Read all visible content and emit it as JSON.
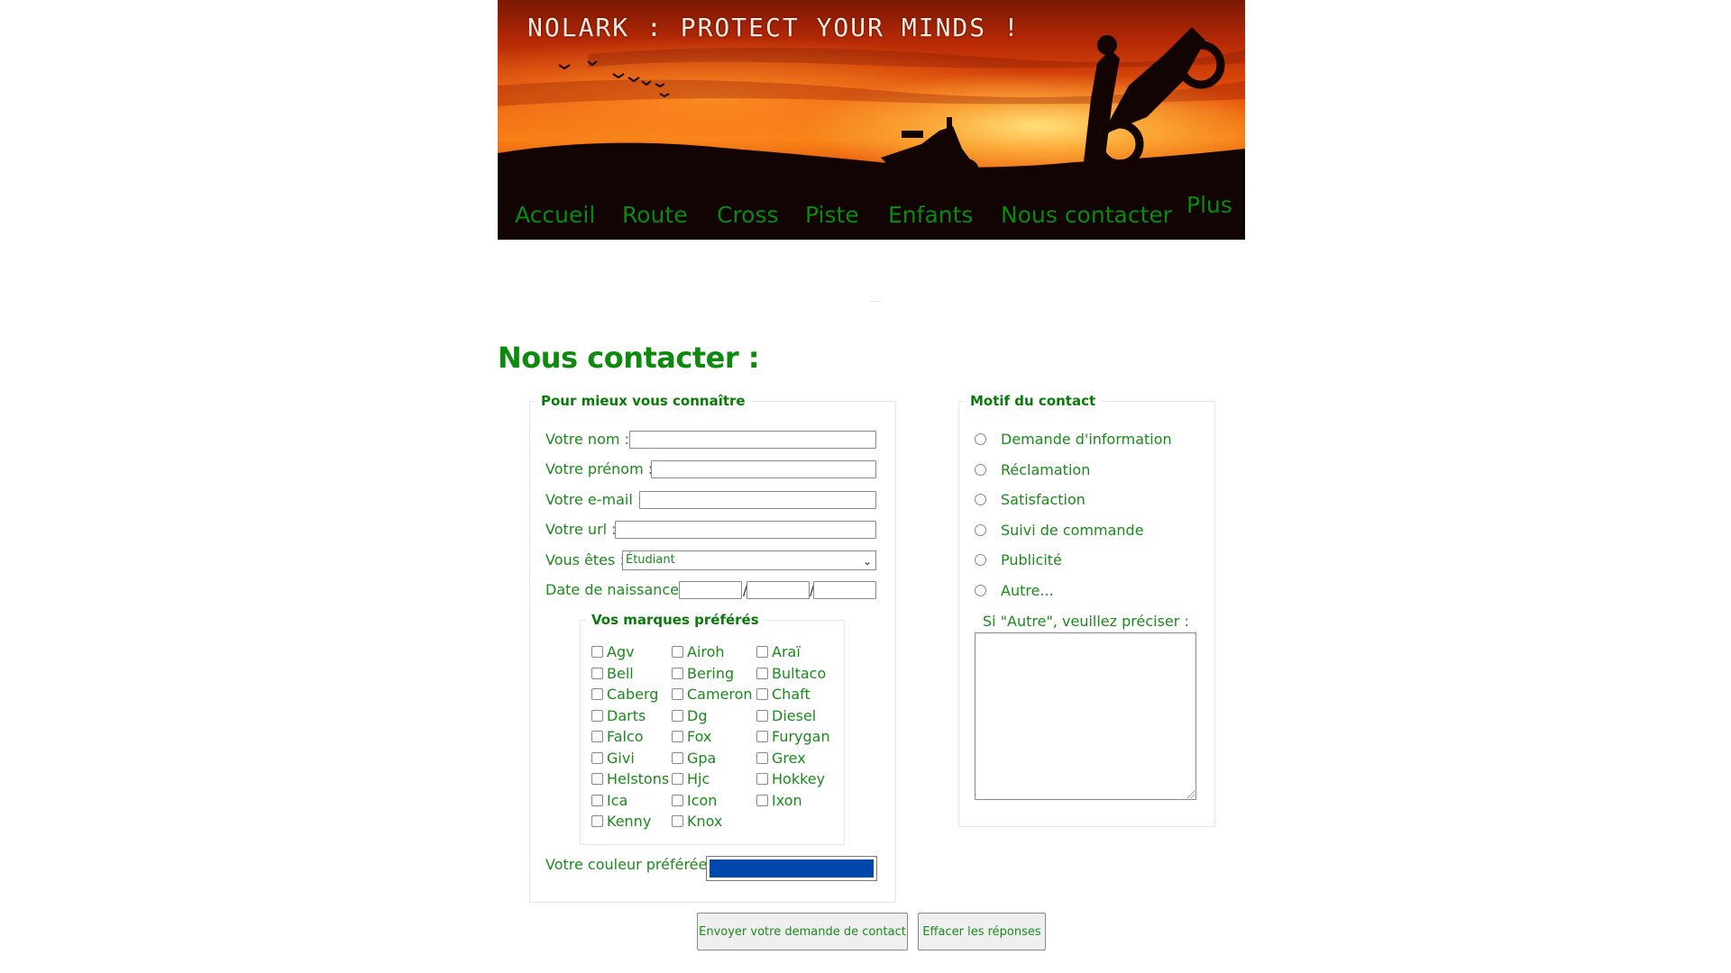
{
  "header": {
    "site_title": "NOLARK : PROTECT YOUR MINDS !",
    "nav": [
      "Accueil",
      "Route",
      "Cross",
      "Piste",
      "Enfants",
      "Nous contacter",
      "Plus"
    ]
  },
  "page_title": "Nous contacter :",
  "personal": {
    "legend": "Pour mieux vous connaître",
    "nom_label": "Votre nom :",
    "prenom_label": "Votre prénom :",
    "email_label": "Votre e-mail :",
    "url_label": "Votre url :",
    "status_label": "Vous êtes :",
    "status_value": "Étudiant",
    "birth_label": "Date de naissance :",
    "birth_sep": "/",
    "color_label": "Votre couleur préférée :",
    "color_value": "#0047ab"
  },
  "brands": {
    "legend": "Vos marques préférés",
    "col1": [
      "Agv",
      "Bell",
      "Caberg",
      "Darts",
      "Falco",
      "Givi",
      "Helstons",
      "Ica",
      "Kenny"
    ],
    "col2": [
      "Airoh",
      "Bering",
      "Cameron",
      "Dg",
      "Fox",
      "Gpa",
      "Hjc",
      "Icon",
      "Knox"
    ],
    "col3": [
      "Araï",
      "Bultaco",
      "Chaft",
      "Diesel",
      "Furygan",
      "Grex",
      "Hokkey",
      "Ixon"
    ]
  },
  "motif": {
    "legend": "Motif du contact",
    "options": [
      "Demande d'information",
      "Réclamation",
      "Satisfaction",
      "Suivi de commande",
      "Publicité",
      "Autre..."
    ],
    "other_label": "Si \"Autre\", veuillez préciser :"
  },
  "buttons": {
    "submit": "Envoyer votre demande de contact",
    "reset": "Effacer les réponses"
  },
  "colors": {
    "green": "#0d8a0d",
    "accent_blue": "#0047ab"
  }
}
